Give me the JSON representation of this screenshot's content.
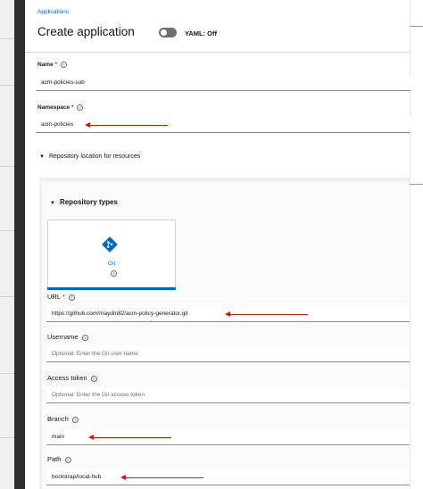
{
  "breadcrumb": "Applications",
  "title": "Create application",
  "yaml_toggle": {
    "label": "YAML: Off",
    "on": false
  },
  "name_field": {
    "label": "Name",
    "required_mark": "*",
    "value": "acm-policies-sub"
  },
  "namespace_field": {
    "label": "Namespace",
    "required_mark": "*",
    "value": "acm-policies"
  },
  "repo_location": {
    "label": "Repository location for resources"
  },
  "repo_types": {
    "label": "Repository types",
    "selected": "Git",
    "git_label": "Git"
  },
  "url_field": {
    "label": "URL",
    "required_mark": "*",
    "value": "https://github.com/maydin82/acm-policy-generator.git"
  },
  "username_field": {
    "label": "Username",
    "placeholder": "Optional: Enter the Git user name"
  },
  "token_field": {
    "label": "Access token",
    "placeholder": "Optional: Enter the Git access token"
  },
  "branch_field": {
    "label": "Branch",
    "value": "main"
  },
  "path_field": {
    "label": "Path",
    "value": "bootstrap/local-hub"
  },
  "colors": {
    "accent": "#0066cc",
    "required": "#c9190b",
    "annotation_arrow": "#c9190b"
  },
  "icons": [
    "help-icon",
    "caret-down-icon",
    "git-icon",
    "red-arrow"
  ]
}
